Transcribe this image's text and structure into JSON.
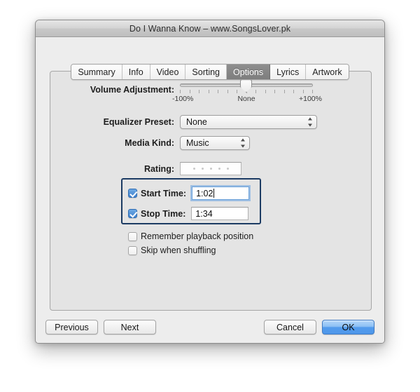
{
  "window": {
    "title": "Do I Wanna Know – www.SongsLover.pk"
  },
  "tabs": [
    {
      "label": "Summary",
      "active": false
    },
    {
      "label": "Info",
      "active": false
    },
    {
      "label": "Video",
      "active": false
    },
    {
      "label": "Sorting",
      "active": false
    },
    {
      "label": "Options",
      "active": true
    },
    {
      "label": "Lyrics",
      "active": false
    },
    {
      "label": "Artwork",
      "active": false
    }
  ],
  "options": {
    "volume": {
      "label": "Volume Adjustment:",
      "min_label": "-100%",
      "mid_label": "None",
      "max_label": "+100%",
      "value_percent": 50,
      "tick_count": 15
    },
    "equalizer": {
      "label": "Equalizer Preset:",
      "value": "None"
    },
    "media_kind": {
      "label": "Media Kind:",
      "value": "Music"
    },
    "rating": {
      "label": "Rating:",
      "stars": 5,
      "filled": 0
    },
    "start_time": {
      "label": "Start Time:",
      "checked": true,
      "value": "1:02",
      "focused": true
    },
    "stop_time": {
      "label": "Stop Time:",
      "checked": true,
      "value": "1:34",
      "focused": false
    },
    "remember_playback": {
      "label": "Remember playback position",
      "checked": false
    },
    "skip_shuffling": {
      "label": "Skip when shuffling",
      "checked": false
    }
  },
  "footer": {
    "previous": "Previous",
    "next": "Next",
    "cancel": "Cancel",
    "ok": "OK"
  },
  "colors": {
    "accent_blue": "#4e97ea",
    "highlight_border": "#1c3b63",
    "checkbox_blue": "#3d7fcc",
    "panel_gray": "#e4e4e4",
    "window_gray": "#ededed"
  }
}
